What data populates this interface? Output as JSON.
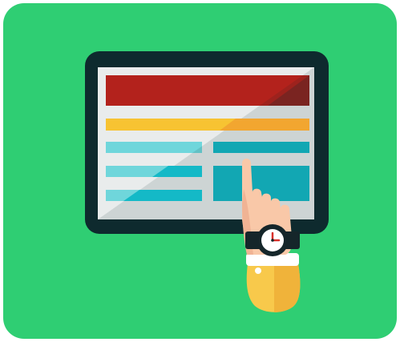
{
  "illustration": {
    "subject": "hand-touching-tablet-webpage-layout",
    "icons": [
      "tablet-icon",
      "hand-pointer-icon",
      "wristwatch-icon"
    ]
  },
  "colors": {
    "background": "#2fce73",
    "tablet_frame": "#0e2a2e",
    "screen": "#e9ecec",
    "header_block": "#b3221c",
    "banner_bar": "#f7c332",
    "banner_bar_shade": "#f2a630",
    "cyan_light": "#6fd6db",
    "cyan_dark": "#14b9c7",
    "skin": "#f9c8a8",
    "skin_shade": "#f0b394",
    "sleeve": "#f8c94b",
    "sleeve_shade": "#f0b33a",
    "cuff": "#ffffff",
    "watch_band": "#15262a",
    "watch_face": "#ffffff",
    "watch_hand": "#d8302a"
  }
}
